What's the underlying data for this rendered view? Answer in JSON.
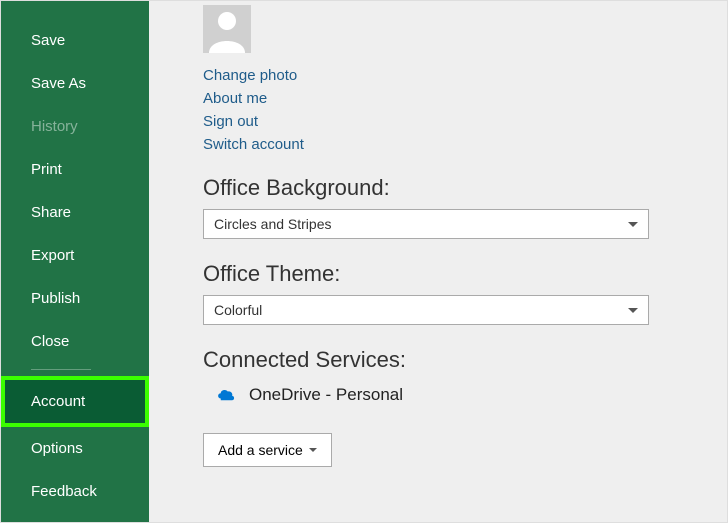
{
  "sidebar": {
    "items": [
      {
        "label": "Save"
      },
      {
        "label": "Save As"
      },
      {
        "label": "History",
        "disabled": true
      },
      {
        "label": "Print"
      },
      {
        "label": "Share"
      },
      {
        "label": "Export"
      },
      {
        "label": "Publish"
      },
      {
        "label": "Close"
      }
    ],
    "bottom": [
      {
        "label": "Account",
        "active": true
      },
      {
        "label": "Options"
      },
      {
        "label": "Feedback"
      }
    ]
  },
  "user": {
    "links": {
      "change_photo": "Change photo",
      "about_me": "About me",
      "sign_out": "Sign out",
      "switch_account": "Switch account"
    }
  },
  "sections": {
    "background_heading": "Office Background:",
    "background_value": "Circles and Stripes",
    "theme_heading": "Office Theme:",
    "theme_value": "Colorful",
    "connected_heading": "Connected Services:"
  },
  "services": [
    {
      "name": "OneDrive - Personal"
    }
  ],
  "buttons": {
    "add_service": "Add a service"
  }
}
